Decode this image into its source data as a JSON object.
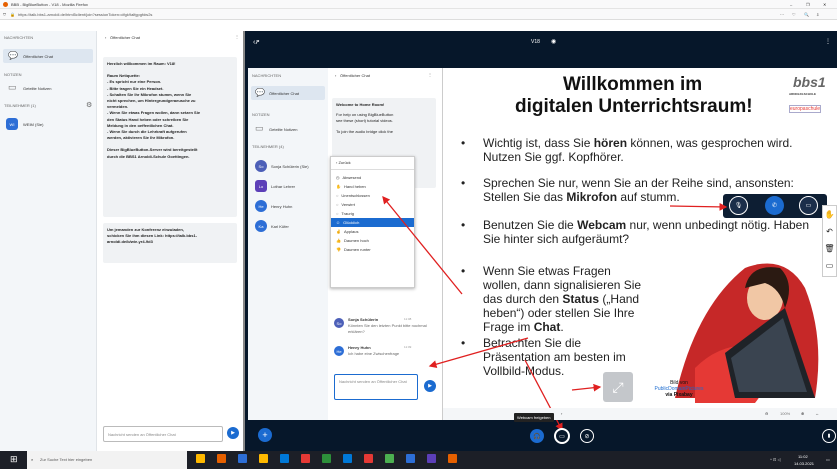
{
  "browser": {
    "window_title": "BBB - BigBlueButton - V18 - Mozilla Firefox",
    "url": "https://talk.bbs1-arnoldi.de/html5client/join?sessionToken=dfgk9alfgpgfdw2s",
    "controls": [
      "–",
      "❐",
      "✕"
    ],
    "toolbar_icons": [
      "···",
      "♡",
      "🔍",
      "⇩"
    ]
  },
  "left_app": {
    "messages_header": "NACHRICHTEN",
    "public_chat_label": "Öffentlicher Chat",
    "notes_header": "NOTIZEN",
    "shared_notes_label": "Geteilte Notizen",
    "users_header": "TEILNEHMER (1)",
    "user_initials": "WI",
    "user_name": "WEIM (Sie)",
    "chat_header": "Öffentlicher Chat",
    "welcome_text": "Herzlich willkommen im Raum: V18!",
    "netiquette_title": "Raum Netiquette:",
    "netiquette_lines": [
      "- Es spricht nur eine Person.",
      "- Bitte tragen Sie ein Headset.",
      "- Schalten Sie Ihr Mikrofon stumm, wenn Sie",
      "nicht sprechen, um Hintergrundgeraeusche zu",
      "vermeiden.",
      "- Wenn Sie etwas Fragen wollen, dann setzen Sie",
      "den Status Hand heben oder schreiben Sie",
      "Meldung in den oeffentlichen Chat.",
      "- Wenn Sie durch die Lehrkraft aufgerufen",
      "werden, aktivieren Sie Ihr Mikrofon."
    ],
    "server_lines": [
      "Dieser BigBlueButton-Server wird bereitgestellt",
      "durch die BBS1 Arnoldi-Schule Goettingen."
    ],
    "invite_lines": [
      "Um jemanden zur Konferenz einzuladen,",
      "schicken Sie ihm diesen Link: https://talk.bbs1-",
      "arnoldi.de/b/wie-yr4-9d3"
    ],
    "input_placeholder": "Nachricht senden an Öffentlicher Chat"
  },
  "inner_app": {
    "room_title": "V18",
    "messages_header": "NACHRICHTEN",
    "public_chat_label": "Öffentlicher Chat",
    "notes_header": "NOTIZEN",
    "shared_notes_label": "Geteilte Notizen",
    "users_header": "TEILNEHMER (4)",
    "users": [
      {
        "initials": "So",
        "name": "Sonja Schülerin (Sie)",
        "color": "#4c5fb8"
      },
      {
        "initials": "Lo",
        "name": "Lothar Lehrer",
        "color": "#5c3fb8"
      },
      {
        "initials": "He",
        "name": "Henry Huhn",
        "color": "#2d6ed6"
      },
      {
        "initials": "Ka",
        "name": "Karl Küfer",
        "color": "#2d6ed6"
      }
    ],
    "chat_header": "Öffentlicher Chat",
    "welcome_lines": [
      "Welcome to Home Room!",
      "For help on using BigBlueButton",
      "see these (short) tutorial videos.",
      "To join the audio bridge click the"
    ],
    "status_menu": {
      "back": "Zurück",
      "items": [
        "Abwesend",
        "Hand heben",
        "Unentschlossen",
        "Verwirrt",
        "Traurig",
        "Glücklich",
        "Applaus",
        "Daumen hoch",
        "Daumen runter"
      ],
      "highlighted": "Glücklich"
    },
    "messages": [
      {
        "initials": "So",
        "name": "Sonja Schülerin",
        "time": "11:08",
        "text": "Könnten Sie den letzten Punkt bitte nochmal erklären?"
      },
      {
        "initials": "He",
        "name": "Henry Huhn",
        "time": "11:09",
        "text": "Ich habe eine Zwischenfrage"
      }
    ],
    "input_placeholder": "Nachricht senden an Öffentlicher Chat",
    "tooltip": "Webcam freigeben",
    "zoom": "100%"
  },
  "slide": {
    "title_line1": "Willkommen im",
    "title_line2": "digitalen Unterrichtsraum!",
    "logo_text": "bbs1",
    "logo_sub": "ARNOLDI-SCHULE",
    "euro_text": "europaschule",
    "bullets": [
      [
        "Wichtig ist, dass Sie ",
        "hören",
        " können, was gesprochen wird. Nutzen Sie ggf. Kopfhörer."
      ],
      [
        "Sprechen Sie nur, wenn Sie an der Reihe sind, ansonsten: Stellen Sie das ",
        "Mikrofon",
        " auf stumm."
      ],
      [
        "Benutzen Sie die ",
        "Webcam",
        " nur, wenn unbedingt nötig. Haben Sie hinter sich aufgeräumt?"
      ],
      [
        "Wenn Sie etwas Fragen wollen, dann signalisieren Sie das durch den ",
        "Status",
        " („Hand heben“) oder stellen Sie Ihre Frage im ",
        "Chat",
        "."
      ],
      [
        "Betrachten Sie die Präsentation am besten im Vollbild-Modus."
      ]
    ],
    "image_credit": [
      "Bild von",
      "PublicDomainPictures",
      "via Pixabay"
    ]
  },
  "taskbar": {
    "search_placeholder": "Zur Suche Text hier eingeben",
    "time": "11:02",
    "date": "14.03.2021"
  }
}
